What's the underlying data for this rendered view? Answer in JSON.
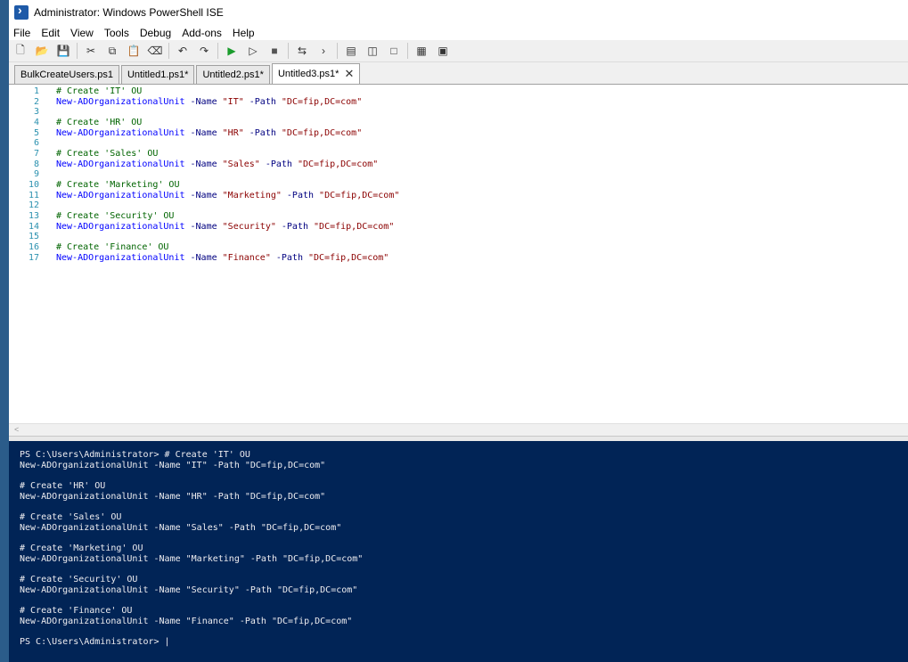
{
  "window": {
    "title": "Administrator: Windows PowerShell ISE"
  },
  "menu": [
    "File",
    "Edit",
    "View",
    "Tools",
    "Debug",
    "Add-ons",
    "Help"
  ],
  "toolbar_icons": [
    "new-icon",
    "open-icon",
    "save-icon",
    "cut-icon",
    "copy-icon",
    "paste-icon",
    "clear-icon",
    "undo-icon",
    "redo-icon",
    "run-icon",
    "run-selection-icon",
    "stop-icon",
    "remote-icon",
    "console-icon",
    "layout-top-icon",
    "layout-right-icon",
    "layout-max-icon",
    "commands-icon",
    "addon-icon"
  ],
  "tabs": [
    {
      "label": "BulkCreateUsers.ps1",
      "active": false
    },
    {
      "label": "Untitled1.ps1*",
      "active": false
    },
    {
      "label": "Untitled2.ps1*",
      "active": false
    },
    {
      "label": "Untitled3.ps1*",
      "active": true
    }
  ],
  "tab_close": "✕",
  "editor": {
    "lines": [
      {
        "n": 1,
        "parts": [
          {
            "t": "# Create 'IT' OU",
            "c": "cm"
          }
        ]
      },
      {
        "n": 2,
        "parts": [
          {
            "t": "New-ADOrganizationalUnit",
            "c": "cmd"
          },
          {
            "t": " -Name ",
            "c": "prm"
          },
          {
            "t": "\"IT\"",
            "c": "str"
          },
          {
            "t": " -Path ",
            "c": "prm"
          },
          {
            "t": "\"DC=fip,DC=com\"",
            "c": "str"
          }
        ]
      },
      {
        "n": 3,
        "parts": []
      },
      {
        "n": 4,
        "parts": [
          {
            "t": "# Create 'HR' OU",
            "c": "cm"
          }
        ]
      },
      {
        "n": 5,
        "parts": [
          {
            "t": "New-ADOrganizationalUnit",
            "c": "cmd"
          },
          {
            "t": " -Name ",
            "c": "prm"
          },
          {
            "t": "\"HR\"",
            "c": "str"
          },
          {
            "t": " -Path ",
            "c": "prm"
          },
          {
            "t": "\"DC=fip,DC=com\"",
            "c": "str"
          }
        ]
      },
      {
        "n": 6,
        "parts": []
      },
      {
        "n": 7,
        "parts": [
          {
            "t": "# Create 'Sales' OU",
            "c": "cm"
          }
        ]
      },
      {
        "n": 8,
        "parts": [
          {
            "t": "New-ADOrganizationalUnit",
            "c": "cmd"
          },
          {
            "t": " -Name ",
            "c": "prm"
          },
          {
            "t": "\"Sales\"",
            "c": "str"
          },
          {
            "t": " -Path ",
            "c": "prm"
          },
          {
            "t": "\"DC=fip,DC=com\"",
            "c": "str"
          }
        ]
      },
      {
        "n": 9,
        "parts": []
      },
      {
        "n": 10,
        "parts": [
          {
            "t": "# Create 'Marketing' OU",
            "c": "cm"
          }
        ]
      },
      {
        "n": 11,
        "parts": [
          {
            "t": "New-ADOrganizationalUnit",
            "c": "cmd"
          },
          {
            "t": " -Name ",
            "c": "prm"
          },
          {
            "t": "\"Marketing\"",
            "c": "str"
          },
          {
            "t": " -Path ",
            "c": "prm"
          },
          {
            "t": "\"DC=fip,DC=com\"",
            "c": "str"
          }
        ]
      },
      {
        "n": 12,
        "parts": []
      },
      {
        "n": 13,
        "parts": [
          {
            "t": "# Create 'Security' OU",
            "c": "cm"
          }
        ]
      },
      {
        "n": 14,
        "parts": [
          {
            "t": "New-ADOrganizationalUnit",
            "c": "cmd"
          },
          {
            "t": " -Name ",
            "c": "prm"
          },
          {
            "t": "\"Security\"",
            "c": "str"
          },
          {
            "t": " -Path ",
            "c": "prm"
          },
          {
            "t": "\"DC=fip,DC=com\"",
            "c": "str"
          }
        ]
      },
      {
        "n": 15,
        "parts": []
      },
      {
        "n": 16,
        "parts": [
          {
            "t": "# Create 'Finance' OU",
            "c": "cm"
          }
        ]
      },
      {
        "n": 17,
        "parts": [
          {
            "t": "New-ADOrganizationalUnit",
            "c": "cmd"
          },
          {
            "t": " -Name ",
            "c": "prm"
          },
          {
            "t": "\"Finance\"",
            "c": "str"
          },
          {
            "t": " -Path ",
            "c": "prm"
          },
          {
            "t": "\"DC=fip,DC=com\"",
            "c": "str"
          }
        ]
      }
    ]
  },
  "console": {
    "lines": [
      "PS C:\\Users\\Administrator> # Create 'IT' OU",
      "New-ADOrganizationalUnit -Name \"IT\" -Path \"DC=fip,DC=com\"",
      "",
      "# Create 'HR' OU",
      "New-ADOrganizationalUnit -Name \"HR\" -Path \"DC=fip,DC=com\"",
      "",
      "# Create 'Sales' OU",
      "New-ADOrganizationalUnit -Name \"Sales\" -Path \"DC=fip,DC=com\"",
      "",
      "# Create 'Marketing' OU",
      "New-ADOrganizationalUnit -Name \"Marketing\" -Path \"DC=fip,DC=com\"",
      "",
      "# Create 'Security' OU",
      "New-ADOrganizationalUnit -Name \"Security\" -Path \"DC=fip,DC=com\"",
      "",
      "# Create 'Finance' OU",
      "New-ADOrganizationalUnit -Name \"Finance\" -Path \"DC=fip,DC=com\"",
      ""
    ],
    "prompt": "PS C:\\Users\\Administrator> |"
  },
  "hscroll_arrow": "<",
  "colors": {
    "console_bg": "#012456",
    "console_fg": "#eeedf0",
    "comment": "#006400",
    "cmdlet": "#0000ff",
    "param": "#000080",
    "string": "#8b0000"
  }
}
